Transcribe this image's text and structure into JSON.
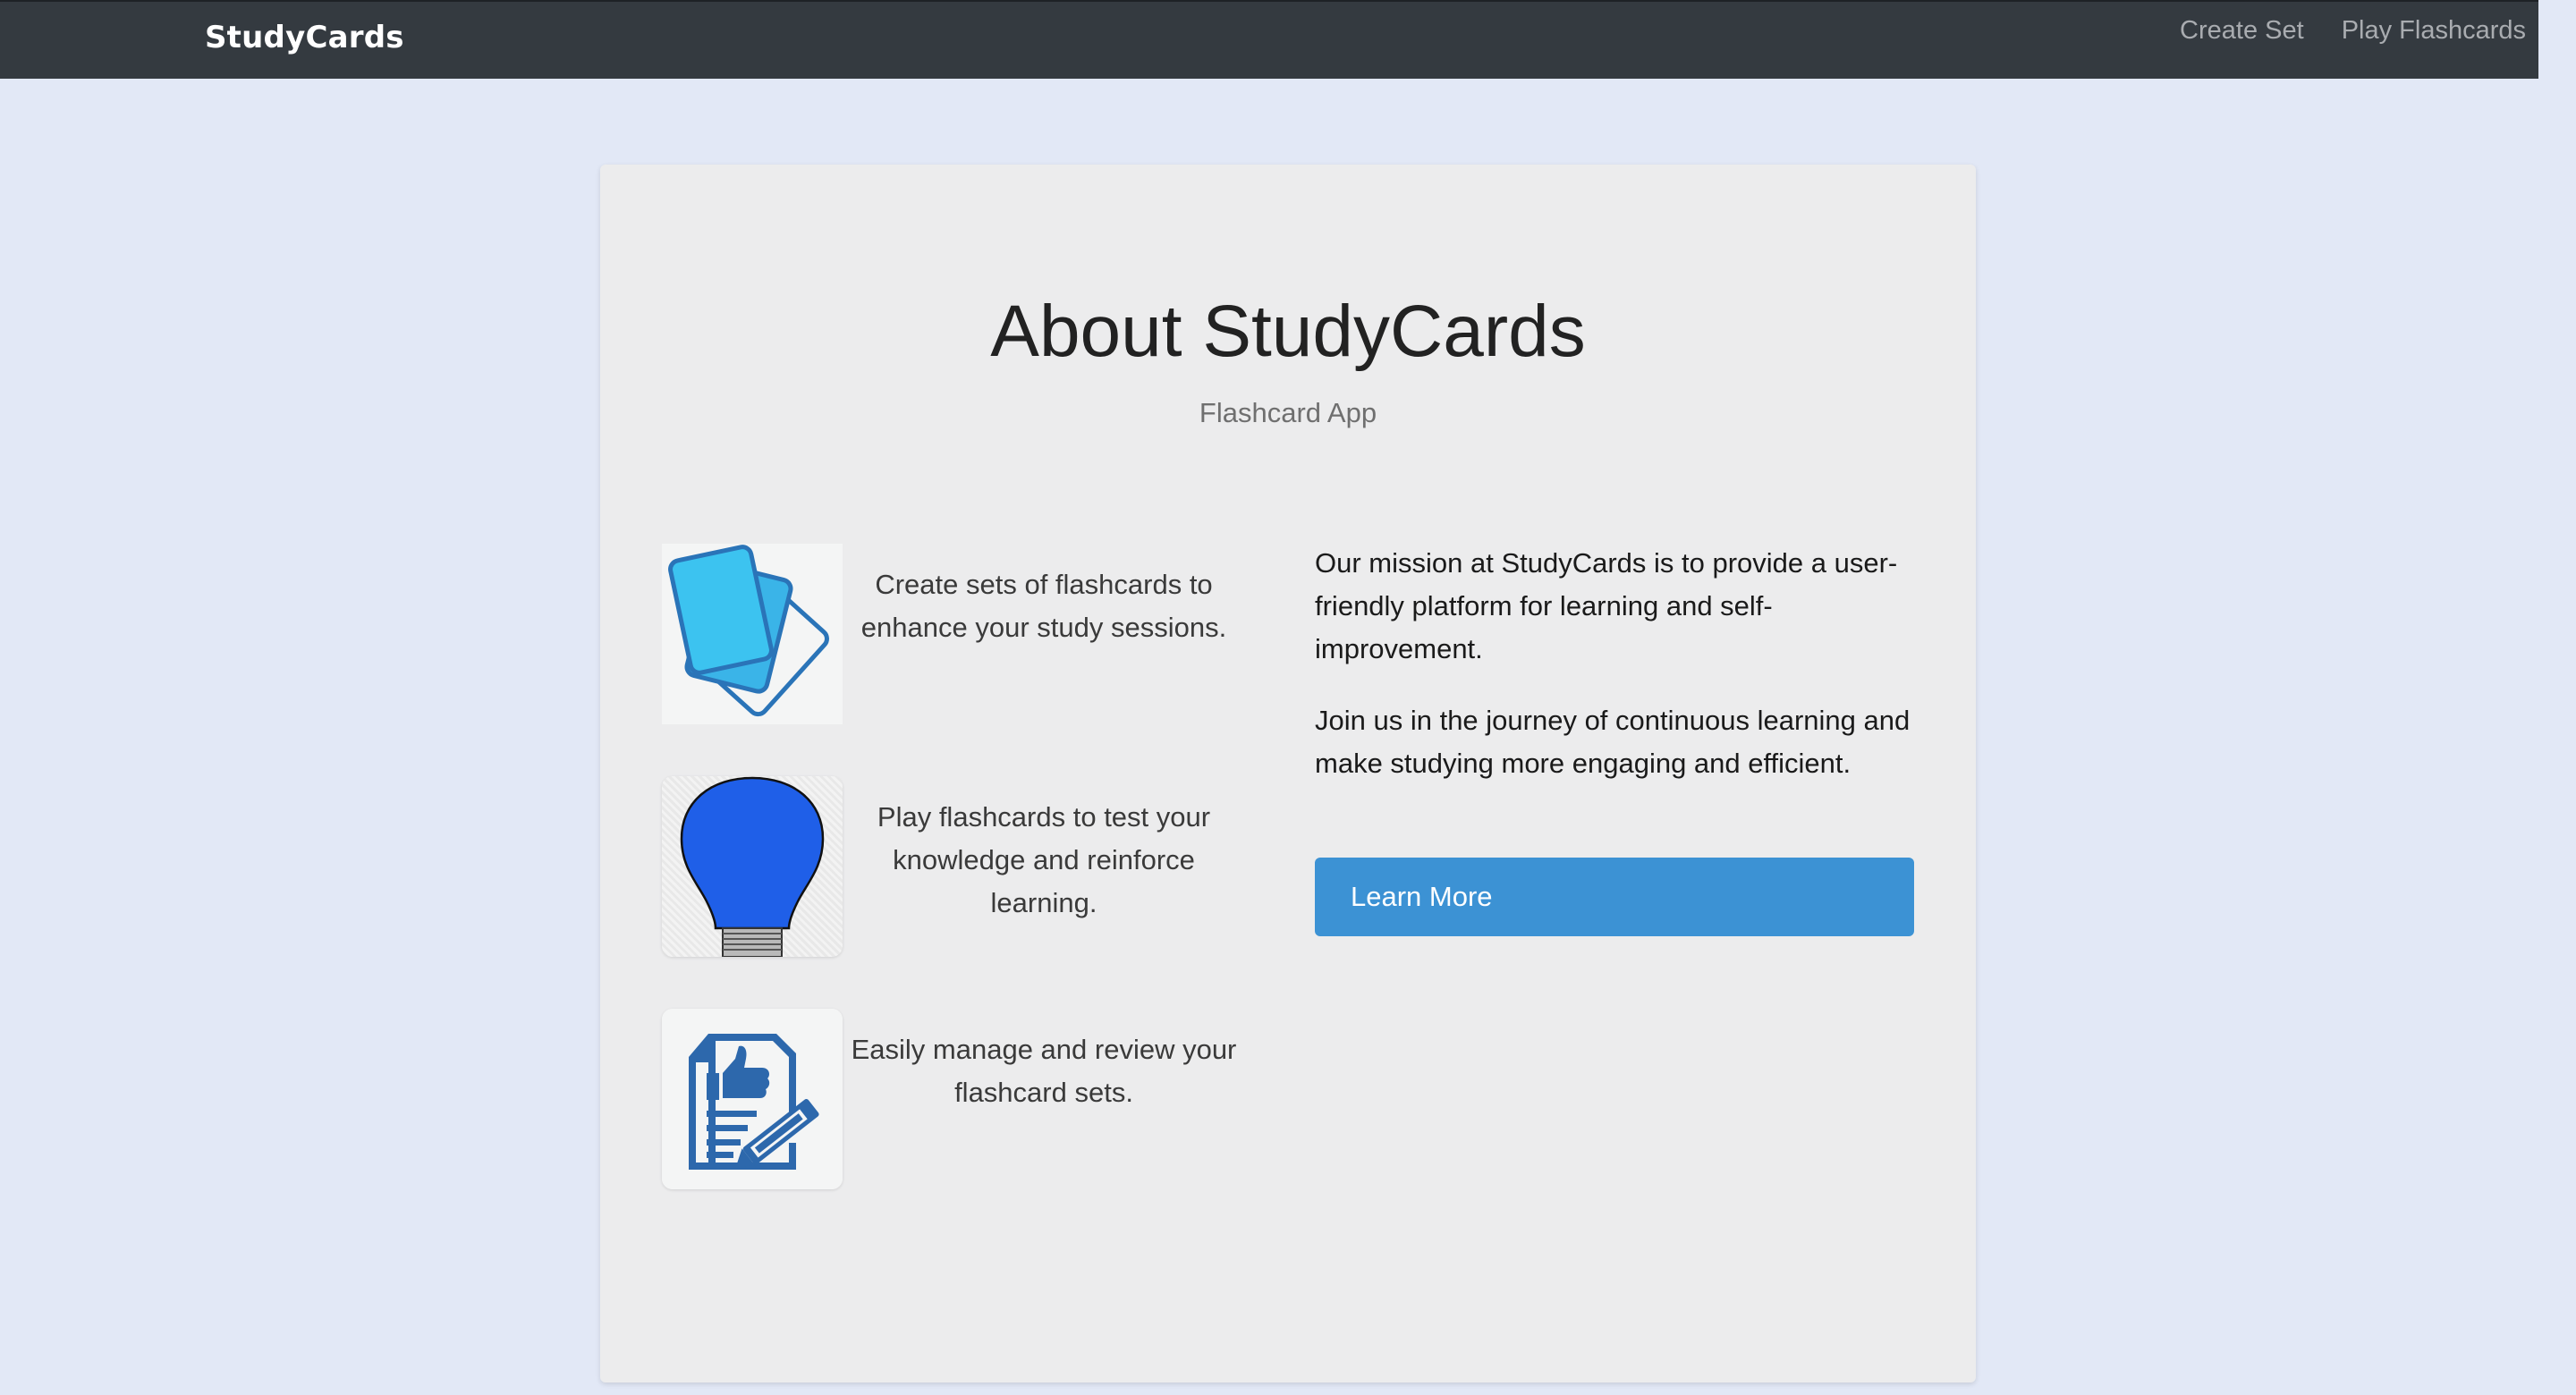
{
  "navbar": {
    "brand": "StudyCards",
    "links": [
      {
        "label": "Create Set"
      },
      {
        "label": "Play Flashcards"
      }
    ]
  },
  "about": {
    "title": "About StudyCards",
    "subtitle": "Flashcard App"
  },
  "features": [
    {
      "icon": "flashcards-icon",
      "text": "Create sets of flashcards to enhance your study sessions."
    },
    {
      "icon": "lightbulb-icon",
      "text": "Play flashcards to test your knowledge and reinforce learning."
    },
    {
      "icon": "document-review-icon",
      "text": "Easily manage and review your flashcard sets."
    }
  ],
  "mission": {
    "paragraph_1": "Our mission at StudyCards is to provide a user-friendly platform for learning and self-improvement.",
    "paragraph_2": "Join us in the journey of continuous learning and make studying more engaging and efficient.",
    "button_label": "Learn More"
  },
  "colors": {
    "navbar_bg": "#343a40",
    "page_bg": "#e2e8f6",
    "card_bg": "#ececed",
    "button_bg": "#3c92d4"
  }
}
